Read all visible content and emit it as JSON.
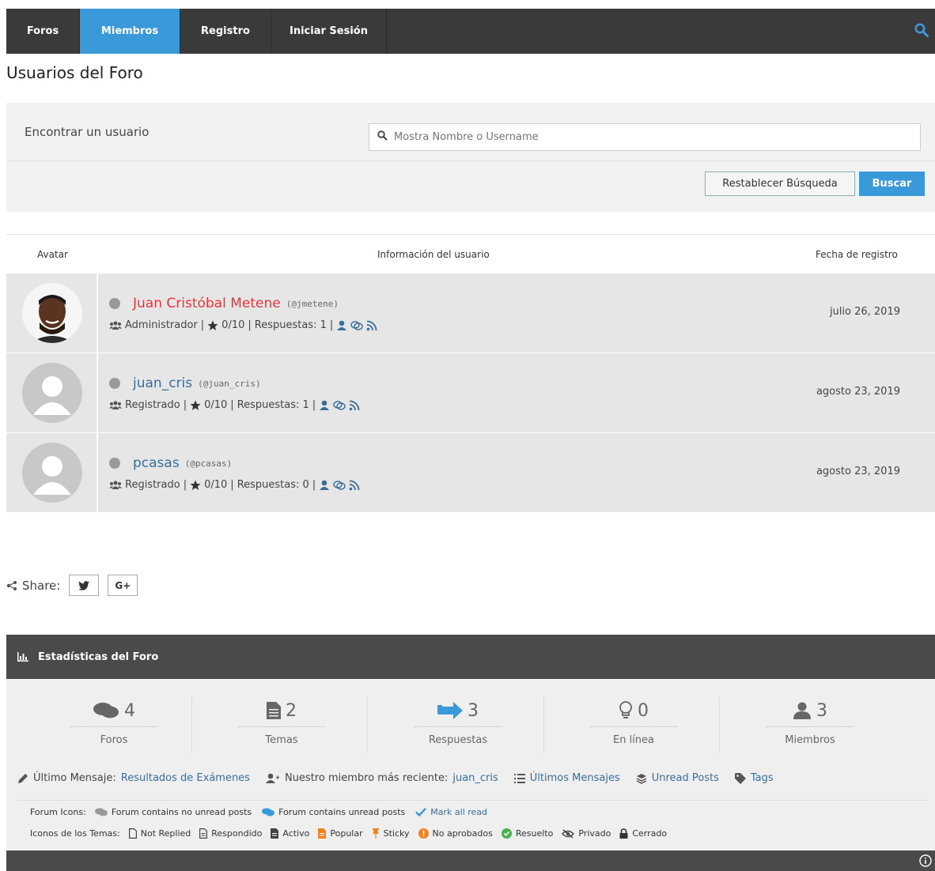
{
  "nav": {
    "items": [
      {
        "label": "Foros"
      },
      {
        "label": "Miembros"
      },
      {
        "label": "Registro"
      },
      {
        "label": "Iniciar Sesión"
      }
    ],
    "active_color": "#3a9ad9"
  },
  "page": {
    "title": "Usuarios del Foro"
  },
  "search": {
    "label": "Encontrar un usuario",
    "placeholder": "Mostra Nombre o Username",
    "reset_label": "Restablecer Búsqueda",
    "submit_label": "Buscar"
  },
  "table": {
    "headers": {
      "avatar": "Avatar",
      "info": "Información del usuario",
      "date": "Fecha de registro"
    },
    "rows": [
      {
        "name": "Juan Cristóbal Metene",
        "handle": "(@jmetene)",
        "role": "Administrador",
        "stars": "0/10",
        "replies": "Respuestas: 1",
        "date": "julio 26, 2019"
      },
      {
        "name": "juan_cris",
        "handle": "(@juan_cris)",
        "role": "Registrado",
        "stars": "0/10",
        "replies": "Respuestas: 1",
        "date": "agosto 23, 2019"
      },
      {
        "name": "pcasas",
        "handle": "(@pcasas)",
        "role": "Registrado",
        "stars": "0/10",
        "replies": "Respuestas: 0",
        "date": "agosto 23, 2019"
      }
    ]
  },
  "share": {
    "label": "Share:",
    "twitter": "🐦",
    "gplus": "G+"
  },
  "stats": {
    "title": "Estadísticas del Foro",
    "items": [
      {
        "value": "4",
        "label": "Foros"
      },
      {
        "value": "2",
        "label": "Temas"
      },
      {
        "value": "3",
        "label": "Respuestas"
      },
      {
        "value": "0",
        "label": "En línea"
      },
      {
        "value": "3",
        "label": "Miembros"
      }
    ],
    "last_post_label": "Último Mensaje:",
    "last_post_link": "Resultados de Exámenes",
    "newest_member_label": "Nuestro miembro más reciente:",
    "newest_member_link": "juan_cris",
    "latest_posts": "Últimos Mensajes",
    "unread_posts": "Unread Posts",
    "tags": "Tags"
  },
  "legend": {
    "forum_icons_label": "Forum Icons:",
    "no_unread": "Forum contains no unread posts",
    "unread": "Forum contains unread posts",
    "mark_read": "Mark all read",
    "topic_icons_label": "Iconos de los Temas:",
    "not_replied": "Not Replied",
    "replied": "Respondido",
    "active": "Activo",
    "popular": "Popular",
    "sticky": "Sticky",
    "unapproved": "No aprobados",
    "solved": "Resuelto",
    "private": "Privado",
    "closed": "Cerrado"
  }
}
